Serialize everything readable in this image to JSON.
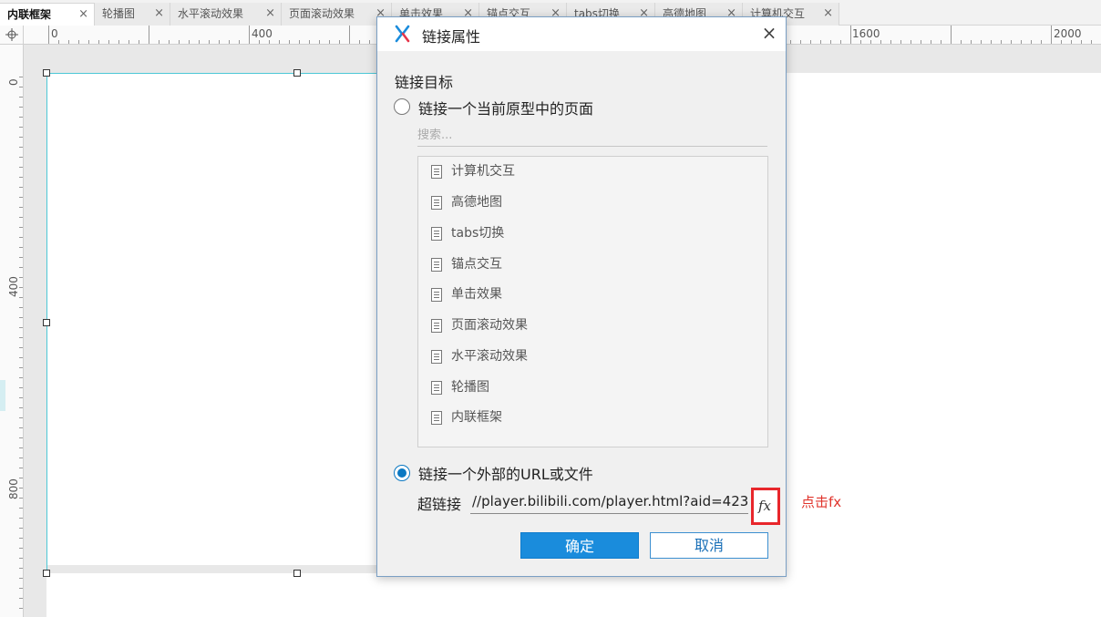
{
  "tabs": [
    {
      "label": "内联框架",
      "active": true
    },
    {
      "label": "轮播图"
    },
    {
      "label": "水平滚动效果"
    },
    {
      "label": "页面滚动效果"
    },
    {
      "label": "单击效果"
    },
    {
      "label": "锚点交互"
    },
    {
      "label": "tabs切换"
    },
    {
      "label": "高德地图"
    },
    {
      "label": "计算机交互"
    }
  ],
  "tab_close_glyph": "×",
  "ruler": {
    "top_labels": [
      "0",
      "400",
      "1600",
      "2000"
    ],
    "left_labels": [
      "0",
      "400",
      "800"
    ],
    "corner_icon": "crosshair-icon"
  },
  "dialog": {
    "title": "链接属性",
    "close_glyph": "×",
    "section_label": "链接目标",
    "option_internal": "链接一个当前原型中的页面",
    "search_placeholder": "搜索...",
    "pages": [
      "计算机交互",
      "高德地图",
      "tabs切换",
      "锚点交互",
      "单击效果",
      "页面滚动效果",
      "水平滚动效果",
      "轮播图",
      "内联框架"
    ],
    "option_external": "链接一个外部的URL或文件",
    "external_selected": true,
    "url_label": "超链接",
    "url_value": "//player.bilibili.com/player.html?aid=423",
    "fx_label": "fx",
    "ok_label": "确定",
    "cancel_label": "取消"
  },
  "annotation": "点击fx",
  "colors": {
    "accent": "#1a8cdc",
    "highlight": "#e8262b",
    "frame_border": "#4dc8d6"
  }
}
